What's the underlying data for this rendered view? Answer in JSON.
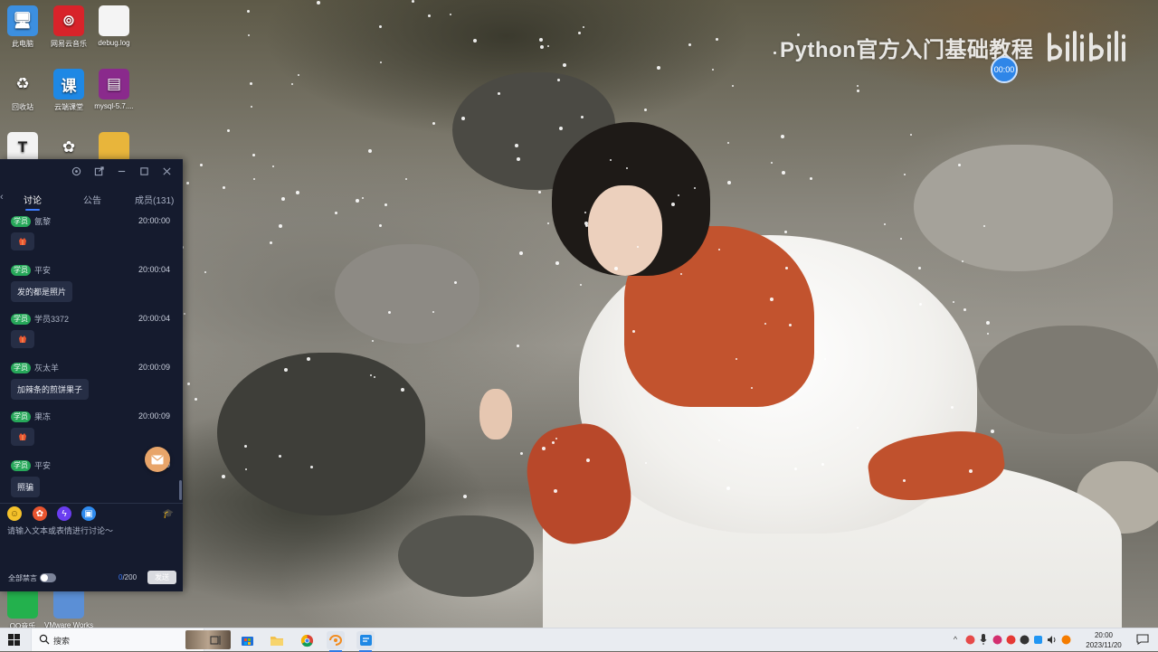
{
  "desktop": {
    "icons": [
      {
        "label": "此电脑",
        "glyph": "🖥",
        "bg": "#3c8fe0"
      },
      {
        "label": "网易云音乐",
        "glyph": "⊚",
        "bg": "#d8232a"
      },
      {
        "label": "debug.log",
        "glyph": "",
        "bg": "#f4f4f4"
      },
      {
        "label": "回收站",
        "glyph": "♻",
        "bg": "transparent"
      },
      {
        "label": "云端课堂",
        "glyph": "课",
        "bg": "#1e88e5"
      },
      {
        "label": "mysql-5.7....",
        "glyph": "▤",
        "bg": "#8a2a8c"
      },
      {
        "label": "",
        "glyph": "T",
        "bg": "#f3f3f3"
      },
      {
        "label": "",
        "glyph": "✿",
        "bg": "transparent"
      },
      {
        "label": "",
        "glyph": "",
        "bg": "#e8b53b"
      },
      {
        "label": "QQ音乐",
        "glyph": "",
        "bg": "#23b14d"
      },
      {
        "label": "VMware Workstati...",
        "glyph": "",
        "bg": "#5b8fd6"
      }
    ]
  },
  "watermark": {
    "title": "Python官方入门基础教程",
    "logo": "bilibili-logo"
  },
  "timer_badge": "00:00",
  "chat": {
    "tabs": [
      "讨论",
      "公告",
      "成员(131)"
    ],
    "active_tab": 0,
    "messages": [
      {
        "role": "学员",
        "name": "氤黎",
        "time": "20:00:00",
        "type": "flower"
      },
      {
        "role": "学员",
        "name": "平安",
        "time": "20:00:04",
        "type": "text",
        "text": "发的都是照片"
      },
      {
        "role": "学员",
        "name": "学员3372",
        "time": "20:00:04",
        "type": "flower"
      },
      {
        "role": "学员",
        "name": "灰太羊",
        "time": "20:00:09",
        "type": "text",
        "text": "加辣条的煎饼果子"
      },
      {
        "role": "学员",
        "name": "果冻",
        "time": "20:00:09",
        "type": "flower"
      },
      {
        "role": "学员",
        "name": "平安",
        "time": "20",
        "type": "text",
        "text": "照骗"
      }
    ],
    "input_placeholder": "请输入文本或表情进行讨论～",
    "mute_all_label": "全部禁言",
    "char_count_current": "0",
    "char_count_max": "/200",
    "send_label": "发送",
    "emoji_icons": [
      "smile-emoji-icon",
      "gift-icon",
      "lightning-icon",
      "image-icon"
    ]
  },
  "taskbar": {
    "search_placeholder": "搜索",
    "apps": [
      "task-view-icon",
      "store-icon",
      "file-explorer-icon",
      "chrome-icon",
      "screen-recorder-icon",
      "classroom-icon"
    ],
    "clock_time": "20:00",
    "clock_date": "2023/11/20"
  },
  "colors": {
    "chat_bg": "#151b2e",
    "accent": "#3d7cff",
    "role_badge": "#27a85a"
  }
}
